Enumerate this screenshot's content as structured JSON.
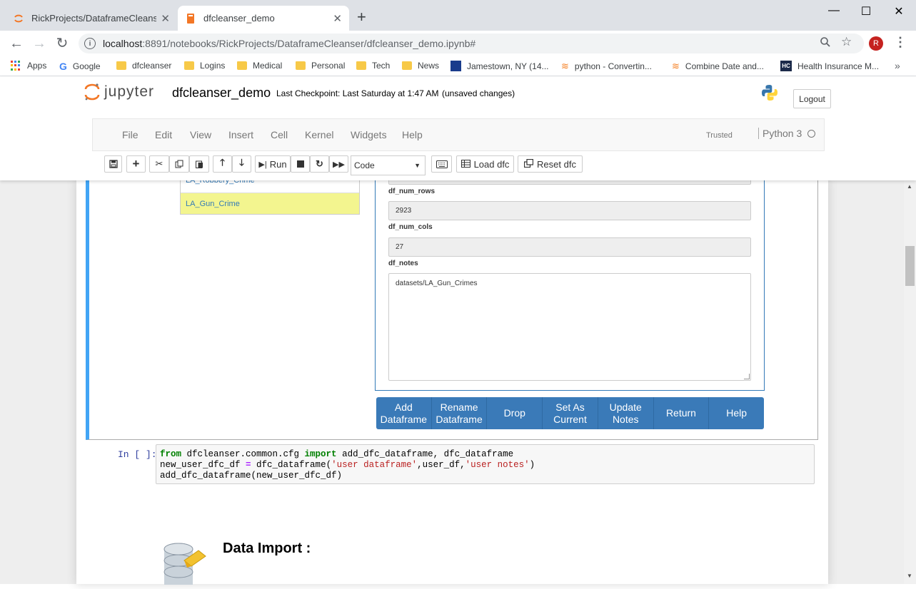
{
  "browser": {
    "tabs": [
      {
        "title": "RickProjects/DataframeCleanser/",
        "close": "✕"
      },
      {
        "title": "dfcleanser_demo",
        "close": "✕"
      }
    ],
    "new_tab": "+",
    "window_controls": {
      "minimize": "—",
      "maximize": "☐",
      "close": "✕"
    },
    "url_host": "localhost",
    "url_rest": ":8891/notebooks/RickProjects/DataframeCleanser/dfcleanser_demo.ipynb#",
    "profile_initial": "R",
    "bookmarks": [
      {
        "label": "Apps",
        "icon": "apps-grid-icon"
      },
      {
        "label": "Google",
        "icon": "google-icon"
      },
      {
        "label": "dfcleanser",
        "icon": "folder-icon"
      },
      {
        "label": "Logins",
        "icon": "folder-icon"
      },
      {
        "label": "Medical",
        "icon": "folder-icon"
      },
      {
        "label": "Personal",
        "icon": "folder-icon"
      },
      {
        "label": "Tech",
        "icon": "folder-icon"
      },
      {
        "label": "News",
        "icon": "folder-icon"
      },
      {
        "label": "Jamestown, NY (14...",
        "icon": "weather-channel-icon"
      },
      {
        "label": "python - Convertin...",
        "icon": "stackoverflow-icon"
      },
      {
        "label": "Combine Date and...",
        "icon": "stackoverflow-icon"
      },
      {
        "label": "Health Insurance M...",
        "icon": "hc-icon"
      }
    ],
    "bookmarks_more": "»"
  },
  "jupyter": {
    "logo_text": "jupyter",
    "notebook_name": "dfcleanser_demo",
    "checkpoint": "Last Checkpoint: Last Saturday at 1:47 AM",
    "autosave_status": "(unsaved changes)",
    "logout_label": "Logout",
    "menus": [
      "File",
      "Edit",
      "View",
      "Insert",
      "Cell",
      "Kernel",
      "Widgets",
      "Help"
    ],
    "trusted_label": "Trusted",
    "kernel_name": "Python 3",
    "toolbar": {
      "run_label": "Run",
      "cell_type": "Code",
      "load_dfc_label": "Load dfc",
      "reset_dfc_label": "Reset dfc"
    }
  },
  "dataframe_list": {
    "items": [
      {
        "name": "LA_Robbery_Crime",
        "selected": false
      },
      {
        "name": "LA_Gun_Crime",
        "selected": true
      }
    ],
    "selected_color": "#f3f58f"
  },
  "form": {
    "fields": [
      {
        "label": "df_num_rows",
        "value": "2923"
      },
      {
        "label": "df_num_cols",
        "value": "27"
      }
    ],
    "notes_label": "df_notes",
    "notes_value": "datasets/LA_Gun_Crimes"
  },
  "actions": [
    {
      "line1": "Add",
      "line2": "Dataframe"
    },
    {
      "line1": "Rename",
      "line2": "Dataframe"
    },
    {
      "line1": "Drop",
      "line2": ""
    },
    {
      "line1": "Set As",
      "line2": "Current"
    },
    {
      "line1": "Update",
      "line2": "Notes"
    },
    {
      "line1": "Return",
      "line2": ""
    },
    {
      "line1": "Help",
      "line2": ""
    }
  ],
  "code_cell": {
    "prompt": "In [ ]:",
    "line1": {
      "kw1": "from",
      "mod": " dfcleanser.common.cfg ",
      "kw2": "import",
      "rest": " add_dfc_dataframe, dfc_dataframe"
    },
    "line2": {
      "a": "new_user_dfc_df ",
      "op": "=",
      "b": " dfc_dataframe(",
      "s1": "'user dataframe'",
      "c": ",user_df,",
      "s2": "'user notes'",
      "d": ")"
    },
    "line3": "add_dfc_dataframe(new_user_dfc_df)"
  },
  "data_import": {
    "title": "Data Import :"
  },
  "colors": {
    "accent": "#3a7ab8",
    "cell_selected_border": "#42a5f5"
  }
}
